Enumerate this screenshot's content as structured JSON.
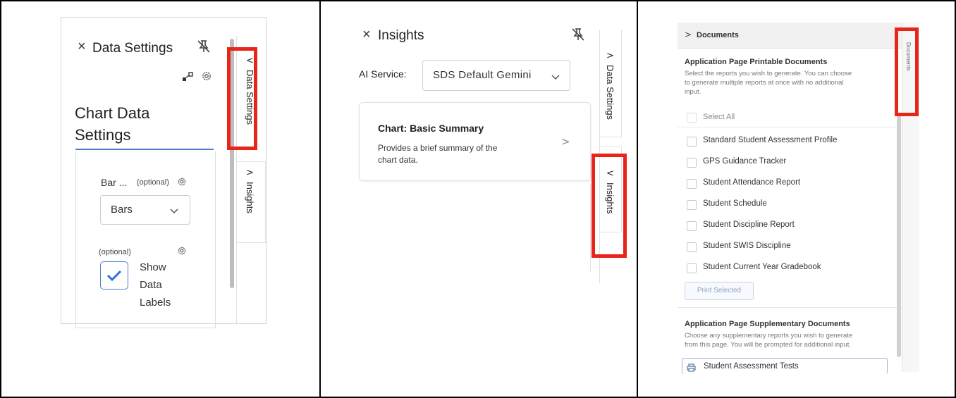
{
  "panel1": {
    "close_glyph": "×",
    "title": "Data Settings",
    "chart_data_title_line1": "Chart Data",
    "chart_data_title_line2": "Settings",
    "bar_label": "Bar ...",
    "optional1": "(optional)",
    "dropdown_value": "Bars",
    "optional2": "(optional)",
    "checkbox_checked": true,
    "show_labels_line1": "Show",
    "show_labels_line2": "Data",
    "show_labels_line3": "Labels",
    "tab_data_settings": "Data Settings",
    "tab_insights": "Insights"
  },
  "panel2": {
    "close_glyph": "×",
    "title": "Insights",
    "ai_service_label": "AI Service:",
    "ai_service_value": "SDS Default Gemini",
    "card_title": "Chart: Basic Summary",
    "card_desc_line1": "Provides a brief summary of the",
    "card_desc_line2": "chart data.",
    "tab_data_settings": "Data Settings",
    "tab_insights": "Insights"
  },
  "panel3": {
    "header": "Documents",
    "printable_title": "Application Page Printable Documents",
    "printable_desc_line1": "Select the reports you wish to generate. You can choose",
    "printable_desc_line2": "to generate multiple reports at once with no additional",
    "printable_desc_line3": "input.",
    "select_all": "Select All",
    "documents": [
      "Standard Student Assessment Profile",
      "GPS Guidance Tracker",
      "Student Attendance Report",
      "Student Schedule",
      "Student Discipline Report",
      "Student SWIS Discipline",
      "Student Current Year Gradebook"
    ],
    "print_button": "Print Selected",
    "supplementary_title": "Application Page Supplementary Documents",
    "supplementary_desc_line1": "Choose any supplementary reports you wish to generate",
    "supplementary_desc_line2": "from this page. You will be prompted for additional input.",
    "supplementary_item": "Student Assessment Tests",
    "tab_documents": "Documents"
  },
  "colors": {
    "highlight": "#e8251b",
    "accent": "#4a7bd0"
  }
}
